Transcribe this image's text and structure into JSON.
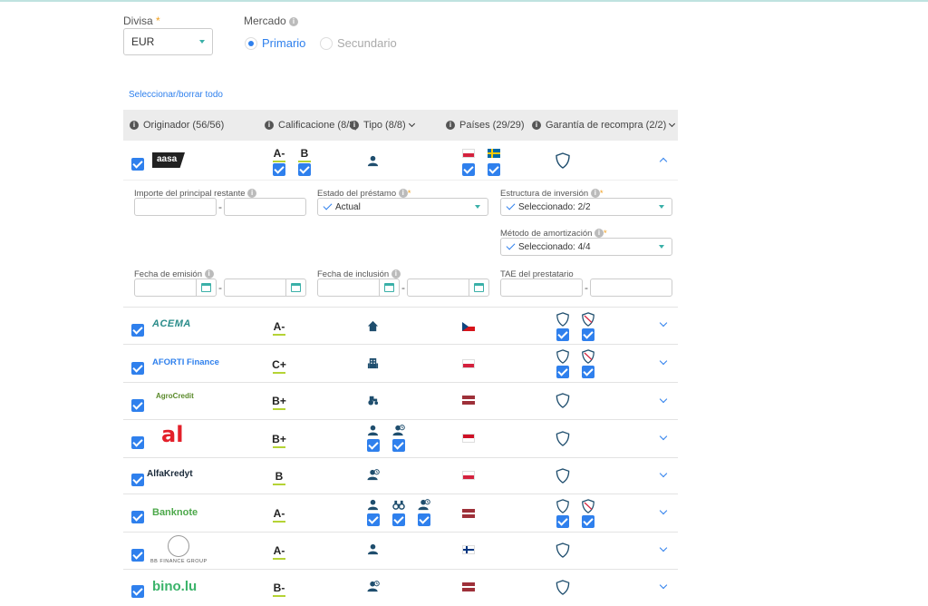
{
  "currency": {
    "label": "Divisa",
    "required_mark": "*",
    "value": "EUR"
  },
  "market": {
    "label": "Mercado",
    "options": [
      {
        "label": "Primario",
        "selected": true
      },
      {
        "label": "Secundario",
        "selected": false
      }
    ]
  },
  "select_all_link": "Seleccionar/borrar todo",
  "table_header": {
    "originator": "Originador (56/56)",
    "rating": "Calificacione (8/8)",
    "type": "Tipo (8/8)",
    "countries": "Países (29/29)",
    "guarantee": "Garantía de recompra (2/2)"
  },
  "info_glyph": "i",
  "colors": {
    "accent": "#2f80ed",
    "teal": "#3ab0a8",
    "navy": "#1f4e6e",
    "rating_underline": "#b5d335"
  },
  "expanded_filters": {
    "principal_label": "Importe del principal restante",
    "loan_status_label": "Estado del préstamo",
    "loan_status_value": "Actual",
    "investment_structure_label": "Estructura de inversión",
    "investment_structure_value": "Seleccionado: 2/2",
    "amortization_label": "Método de amortización",
    "amortization_value": "Seleccionado: 4/4",
    "issue_date_label": "Fecha de emisión",
    "inclusion_date_label": "Fecha de inclusión",
    "apr_label": "TAE del prestatario",
    "dash": "-",
    "required_mark": "*"
  },
  "rows": [
    {
      "logo": "aasa",
      "ratings": [
        "A-",
        "B"
      ],
      "types": [
        "person-icon"
      ],
      "flags": [
        "pl",
        "se"
      ],
      "guarantees": 1,
      "expanded": true
    },
    {
      "logo": "ACEMA",
      "ratings": [
        "A-"
      ],
      "types": [
        "house-icon"
      ],
      "flags": [
        "cz"
      ],
      "guarantees": 2
    },
    {
      "logo": "AFORTI Finance",
      "ratings": [
        "C+"
      ],
      "types": [
        "building-icon"
      ],
      "flags": [
        "pl"
      ],
      "guarantees": 2
    },
    {
      "logo": "AgroCredit",
      "ratings": [
        "B+"
      ],
      "types": [
        "tractor-icon"
      ],
      "flags": [
        "lv"
      ],
      "guarantees": 1
    },
    {
      "logo": "al",
      "ratings": [
        "B+"
      ],
      "types": [
        "person-icon",
        "person-clock-icon"
      ],
      "flags": [
        "id"
      ],
      "guarantees": 1
    },
    {
      "logo": "AlfaKredyt",
      "ratings": [
        "B"
      ],
      "types": [
        "person-clock-icon"
      ],
      "flags": [
        "pl"
      ],
      "guarantees": 1
    },
    {
      "logo": "Banknote",
      "ratings": [
        "A-"
      ],
      "types": [
        "person-icon",
        "binoculars-icon",
        "person-clock-icon"
      ],
      "flags": [
        "lv"
      ],
      "guarantees": 2
    },
    {
      "logo": "BB FINANCE GROUP",
      "ratings": [
        "A-"
      ],
      "types": [
        "person-icon"
      ],
      "flags": [
        "fi"
      ],
      "guarantees": 1
    },
    {
      "logo": "bino.lu",
      "ratings": [
        "B-"
      ],
      "types": [
        "person-clock-icon"
      ],
      "flags": [
        "lv"
      ],
      "guarantees": 1
    }
  ]
}
